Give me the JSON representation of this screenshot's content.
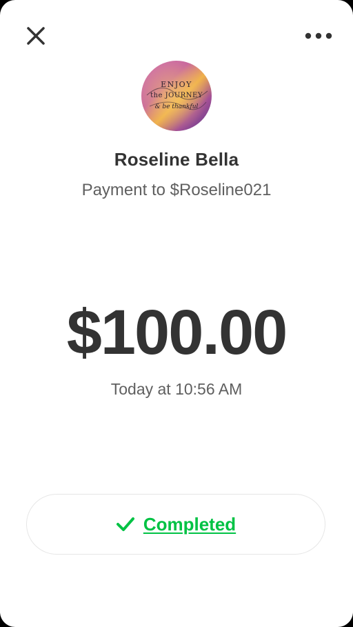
{
  "header": {
    "close_icon": "close-icon",
    "more_icon": "more-horizontal-icon"
  },
  "recipient": {
    "avatar_text": [
      "ENJOY",
      "the JOURNEY",
      "& be thankful"
    ],
    "name": "Roseline Bella",
    "subtitle": "Payment to $Roseline021"
  },
  "payment": {
    "amount": "$100.00",
    "timestamp": "Today at 10:56 AM"
  },
  "status": {
    "label": "Completed",
    "icon": "checkmark-icon",
    "color": "#00c244"
  },
  "colors": {
    "text_primary": "#333333",
    "text_secondary": "#5f5f5f",
    "accent_green": "#00c244"
  }
}
